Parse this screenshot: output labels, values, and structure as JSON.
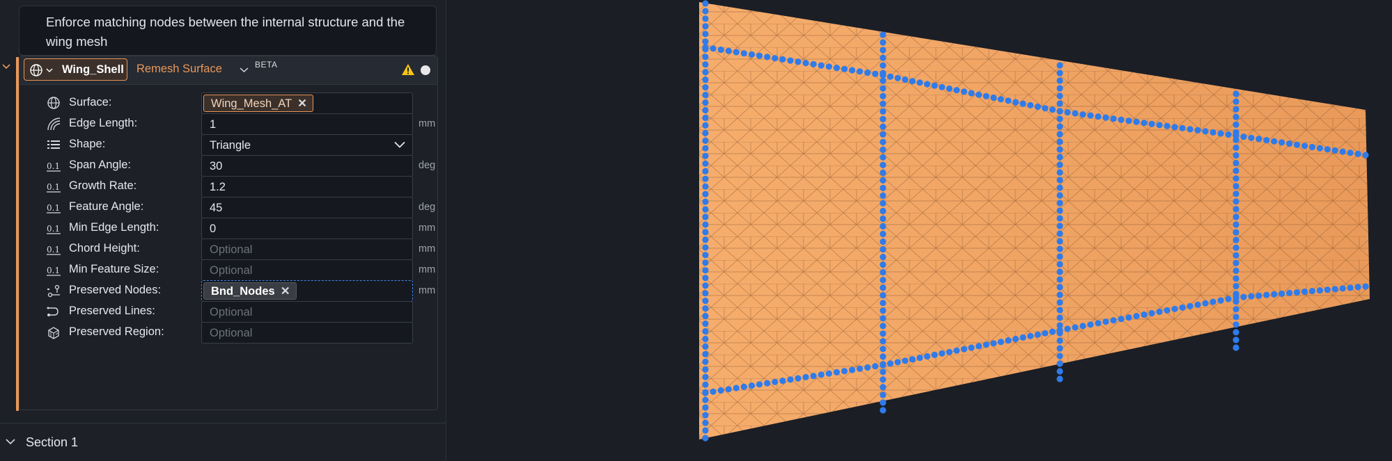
{
  "description": "Enforce matching nodes between the internal structure and the wing mesh",
  "node": {
    "input_chip": "Wing_Shell",
    "operation": "Remesh Surface",
    "badge": "BETA",
    "warning_icon": "warning-triangle-icon",
    "accent_color": "#e8975a"
  },
  "params": [
    {
      "key": "surface",
      "label": "Surface:",
      "icon": "globe-icon",
      "type": "tag",
      "tag": "Wing_Mesh_AT"
    },
    {
      "key": "edge_length",
      "label": "Edge Length:",
      "icon": "edge-length-icon",
      "type": "value",
      "value": "1",
      "unit": "mm"
    },
    {
      "key": "shape",
      "label": "Shape:",
      "icon": "list-icon",
      "type": "dropdown",
      "value": "Triangle"
    },
    {
      "key": "span_angle",
      "label": "Span Angle:",
      "icon": "number-icon",
      "type": "value",
      "value": "30",
      "unit": "deg"
    },
    {
      "key": "growth_rate",
      "label": "Growth Rate:",
      "icon": "number-icon",
      "type": "value",
      "value": "1.2"
    },
    {
      "key": "feature_angle",
      "label": "Feature Angle:",
      "icon": "number-icon",
      "type": "value",
      "value": "45",
      "unit": "deg"
    },
    {
      "key": "min_edge_length",
      "label": "Min Edge Length:",
      "icon": "number-icon",
      "type": "value",
      "value": "0",
      "unit": "mm"
    },
    {
      "key": "chord_height",
      "label": "Chord Height:",
      "icon": "number-icon",
      "type": "placeholder",
      "placeholder": "Optional",
      "unit": "mm"
    },
    {
      "key": "min_feature_size",
      "label": "Min Feature Size:",
      "icon": "number-icon",
      "type": "placeholder",
      "placeholder": "Optional",
      "unit": "mm"
    },
    {
      "key": "preserved_nodes",
      "label": "Preserved Nodes:",
      "icon": "nodes-icon",
      "type": "tag-grey",
      "tag": "Bnd_Nodes",
      "unit": "mm"
    },
    {
      "key": "preserved_lines",
      "label": "Preserved Lines:",
      "icon": "lines-icon",
      "type": "placeholder",
      "placeholder": "Optional"
    },
    {
      "key": "preserved_region",
      "label": "Preserved Region:",
      "icon": "region-icon",
      "type": "placeholder",
      "placeholder": "Optional"
    }
  ],
  "section": {
    "title": "Section 1"
  },
  "viewport": {
    "mesh_color": "#f0a464",
    "node_color": "#2f7bea"
  }
}
